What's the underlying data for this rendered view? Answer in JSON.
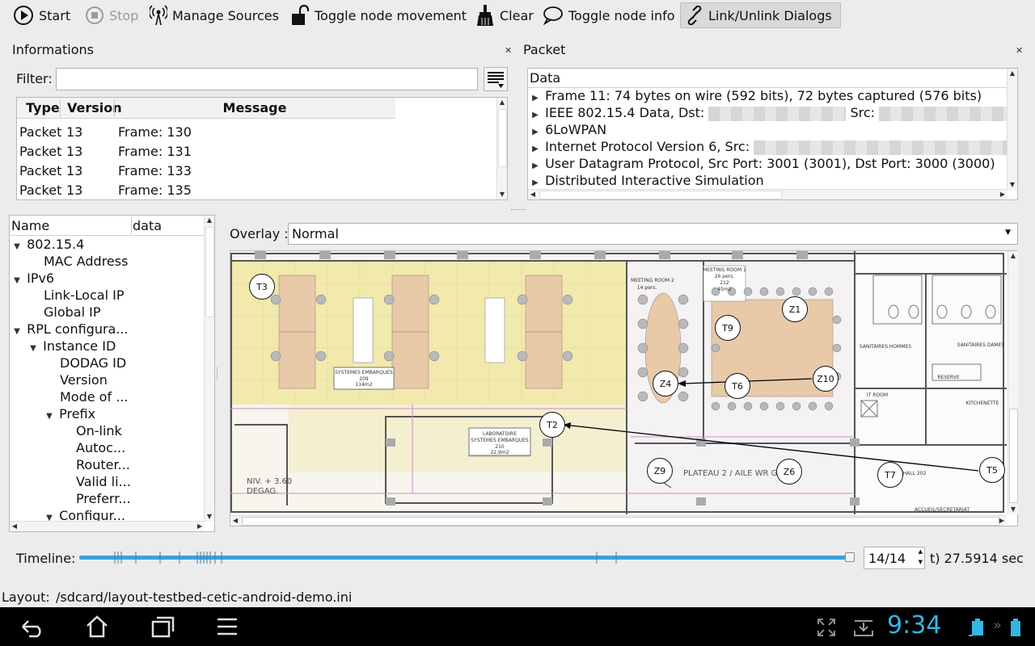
{
  "toolbar": {
    "start": "Start",
    "stop": "Stop",
    "manage_sources": "Manage Sources",
    "toggle_node_movement": "Toggle node movement",
    "clear": "Clear",
    "toggle_node_info": "Toggle node info",
    "link_unlink": "Link/Unlink Dialogs"
  },
  "informations": {
    "title": "Informations",
    "filter_label": "Filter:",
    "filter_value": "",
    "columns": [
      "Type",
      "Version",
      "Message"
    ],
    "rows": [
      {
        "type": "Packet",
        "version": "13",
        "message": "Frame: 130"
      },
      {
        "type": "Packet",
        "version": "13",
        "message": "Frame: 131"
      },
      {
        "type": "Packet",
        "version": "13",
        "message": "Frame: 133"
      },
      {
        "type": "Packet",
        "version": "13",
        "message": "Frame: 135"
      }
    ]
  },
  "packet": {
    "title": "Packet",
    "header": "Data",
    "lines": [
      "Frame 11: 74 bytes on wire (592 bits), 72 bytes captured (576 bits)",
      "IEEE 802.15.4 Data, Dst:",
      "Src:",
      "6LoWPAN",
      "Internet Protocol Version 6, Src:",
      "User Datagram Protocol, Src Port: 3001 (3001), Dst Port: 3000 (3000)",
      "Distributed Interactive Simulation"
    ]
  },
  "tree": {
    "columns": [
      "Name",
      "data"
    ],
    "items": [
      "802.15.4",
      "MAC Address",
      "IPv6",
      "Link-Local IP",
      "Global IP",
      "RPL configura...",
      "Instance ID",
      "DODAG ID",
      "Version",
      "Mode of ...",
      "Prefix",
      "On-link",
      "Autoc...",
      "Router...",
      "Valid li...",
      "Preferr...",
      "Configur..."
    ]
  },
  "overlay": {
    "label": "Overlay :",
    "selected": "Normal"
  },
  "map": {
    "nodes": [
      "T3",
      "Z1",
      "T9",
      "Z4",
      "T6",
      "Z10",
      "T2",
      "Z9",
      "Z6",
      "T7",
      "T5"
    ],
    "labels": {
      "room1": "SYSTEMES EMBARQUES",
      "room1_num": "209",
      "room1_area": "114m2",
      "lab": "LABORATOIRE",
      "lab2": "SYSTEMES EMBARQUES",
      "lab_num": "210",
      "lab_area": "22,9m2",
      "plateau": "PLATEAU 2 / AILE WR G",
      "meeting": "MEETING ROOM 1",
      "meeting_pers": "26 pers.",
      "meeting_num": "212",
      "meeting_area": "45m2",
      "meeting2": "MEETING ROOM 2",
      "meeting2_pers": "14 pers.",
      "sanitaires_h": "SANITAIRES HOMMES",
      "sanitaires_d": "SANITAIRES DAMES",
      "reserve": "RESERVE",
      "kitchenette": "KITCHENETTE",
      "it_room": "IT ROOM",
      "accueil": "ACCUEIL/SECRETARIAT",
      "niv": "NIV. + 3.60",
      "degag": "DEGAG.",
      "hall": "HALL 202"
    }
  },
  "timeline": {
    "label": "Timeline:",
    "spin_value": "14/14",
    "time_text": "t) 27.5914 sec",
    "position_fraction": 1.0
  },
  "layout_bar": {
    "label": "Layout:",
    "path": "/sdcard/layout-testbed-cetic-android-demo.ini"
  },
  "statusbar": {
    "clock": "9:34"
  },
  "colors": {
    "accent": "#3aa3d6",
    "clock": "#33b5e5"
  }
}
